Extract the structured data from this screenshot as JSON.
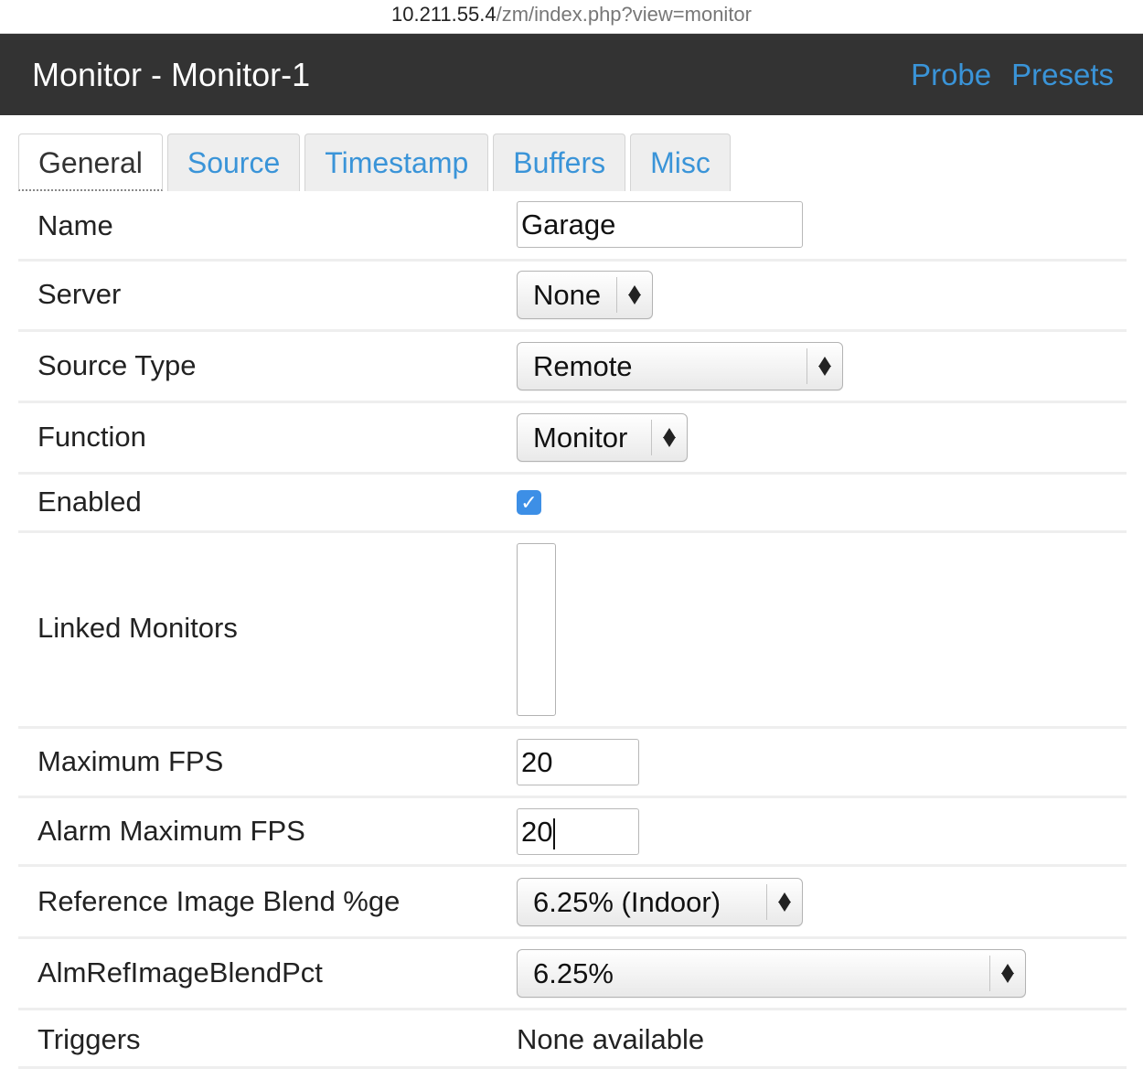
{
  "url": {
    "host": "10.211.55.4",
    "path": "/zm/index.php?view=monitor"
  },
  "header": {
    "title": "Monitor - Monitor-1",
    "links": [
      "Probe",
      "Presets"
    ]
  },
  "tabs": [
    {
      "label": "General",
      "active": true
    },
    {
      "label": "Source",
      "active": false
    },
    {
      "label": "Timestamp",
      "active": false
    },
    {
      "label": "Buffers",
      "active": false
    },
    {
      "label": "Misc",
      "active": false
    }
  ],
  "form": {
    "name": {
      "label": "Name",
      "value": "Garage"
    },
    "server": {
      "label": "Server",
      "value": "None"
    },
    "source_type": {
      "label": "Source Type",
      "value": "Remote"
    },
    "function": {
      "label": "Function",
      "value": "Monitor"
    },
    "enabled": {
      "label": "Enabled",
      "checked": true,
      "check_glyph": "✓"
    },
    "linked_monitors": {
      "label": "Linked Monitors",
      "options": []
    },
    "max_fps": {
      "label": "Maximum FPS",
      "value": "20"
    },
    "alarm_max_fps": {
      "label": "Alarm Maximum FPS",
      "value": "20"
    },
    "ref_blend": {
      "label": "Reference Image Blend %ge",
      "value": "6.25% (Indoor)"
    },
    "alm_ref_blend": {
      "label": "AlmRefImageBlendPct",
      "value": "6.25%"
    },
    "triggers": {
      "label": "Triggers",
      "value": "None available"
    }
  },
  "colors": {
    "header_bg": "#333333",
    "link": "#3a94d8",
    "checkbox": "#3d8fe6"
  }
}
